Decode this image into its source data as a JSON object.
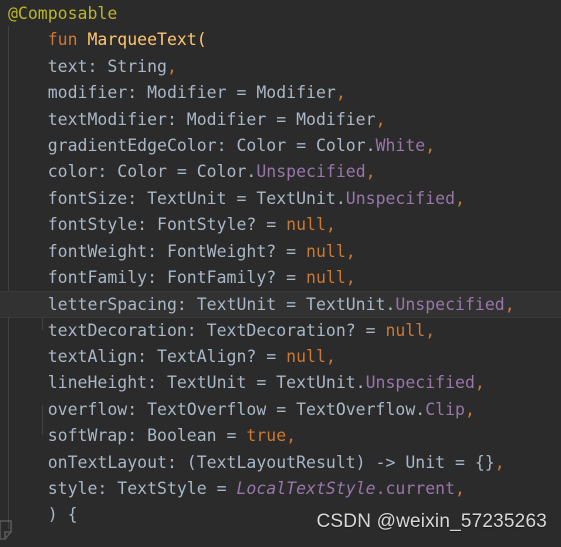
{
  "editor": {
    "theme_name": "darcula",
    "background": "#2b2b2b",
    "current_line_background": "#323232",
    "default_text_color": "#a9b7c6",
    "language": "kotlin",
    "colors": {
      "annotation": "#bbb529",
      "keyword": "#cc7832",
      "function_declaration": "#ffc66d",
      "static_field": "#9876aa",
      "identifier": "#a9b7c6"
    },
    "lines": [
      {
        "index": 1,
        "current": false,
        "tokens": [
          {
            "text": "@Composable",
            "type": "annotation"
          }
        ]
      },
      {
        "index": 2,
        "current": false,
        "tokens": [
          {
            "text": "    ",
            "type": "default"
          },
          {
            "text": "fun",
            "type": "keyword"
          },
          {
            "text": " ",
            "type": "default"
          },
          {
            "text": "MarqueeText",
            "type": "function_declaration"
          },
          {
            "text": "(",
            "type": "function_declaration"
          }
        ]
      },
      {
        "index": 3,
        "current": false,
        "tokens": [
          {
            "text": "    text: String",
            "type": "default"
          },
          {
            "text": ",",
            "type": "keyword"
          }
        ]
      },
      {
        "index": 4,
        "current": false,
        "tokens": [
          {
            "text": "    modifier: Modifier = Modifier",
            "type": "default"
          },
          {
            "text": ",",
            "type": "keyword"
          }
        ]
      },
      {
        "index": 5,
        "current": false,
        "tokens": [
          {
            "text": "    textModifier: Modifier = Modifier",
            "type": "default"
          },
          {
            "text": ",",
            "type": "keyword"
          }
        ]
      },
      {
        "index": 6,
        "current": false,
        "tokens": [
          {
            "text": "    gradientEdgeColor: Color = Color.",
            "type": "default"
          },
          {
            "text": "White",
            "type": "static_field"
          },
          {
            "text": ",",
            "type": "keyword"
          }
        ]
      },
      {
        "index": 7,
        "current": false,
        "tokens": [
          {
            "text": "    color: Color = Color.",
            "type": "default"
          },
          {
            "text": "Unspecified",
            "type": "static_field"
          },
          {
            "text": ",",
            "type": "keyword"
          }
        ]
      },
      {
        "index": 8,
        "current": false,
        "tokens": [
          {
            "text": "    fontSize: TextUnit = TextUnit.",
            "type": "default"
          },
          {
            "text": "Unspecified",
            "type": "static_field"
          },
          {
            "text": ",",
            "type": "keyword"
          }
        ]
      },
      {
        "index": 9,
        "current": false,
        "tokens": [
          {
            "text": "    fontStyle: FontStyle? = ",
            "type": "default"
          },
          {
            "text": "null",
            "type": "keyword"
          },
          {
            "text": ",",
            "type": "keyword"
          }
        ]
      },
      {
        "index": 10,
        "current": false,
        "tokens": [
          {
            "text": "    fontWeight: FontWeight? = ",
            "type": "default"
          },
          {
            "text": "null",
            "type": "keyword"
          },
          {
            "text": ",",
            "type": "keyword"
          }
        ]
      },
      {
        "index": 11,
        "current": false,
        "tokens": [
          {
            "text": "    fontFamily: FontFamily? = ",
            "type": "default"
          },
          {
            "text": "null",
            "type": "keyword"
          },
          {
            "text": ",",
            "type": "keyword"
          }
        ]
      },
      {
        "index": 12,
        "current": true,
        "tokens": [
          {
            "text": "    letterSpacing: TextUnit = TextUnit.",
            "type": "default"
          },
          {
            "text": "Unspecified",
            "type": "static_field"
          },
          {
            "text": ",",
            "type": "keyword"
          }
        ]
      },
      {
        "index": 13,
        "current": false,
        "tokens": [
          {
            "text": "    textDecoration: TextDecoration? = ",
            "type": "default"
          },
          {
            "text": "null",
            "type": "keyword"
          },
          {
            "text": ",",
            "type": "keyword"
          }
        ]
      },
      {
        "index": 14,
        "current": false,
        "tokens": [
          {
            "text": "    textAlign: TextAlign? = ",
            "type": "default"
          },
          {
            "text": "null",
            "type": "keyword"
          },
          {
            "text": ",",
            "type": "keyword"
          }
        ]
      },
      {
        "index": 15,
        "current": false,
        "tokens": [
          {
            "text": "    lineHeight: TextUnit = TextUnit.",
            "type": "default"
          },
          {
            "text": "Unspecified",
            "type": "static_field"
          },
          {
            "text": ",",
            "type": "keyword"
          }
        ]
      },
      {
        "index": 16,
        "current": false,
        "tokens": [
          {
            "text": "    overflow: TextOverflow = TextOverflow.",
            "type": "default"
          },
          {
            "text": "Clip",
            "type": "static_field"
          },
          {
            "text": ",",
            "type": "keyword"
          }
        ]
      },
      {
        "index": 17,
        "current": false,
        "tokens": [
          {
            "text": "    softWrap: Boolean = ",
            "type": "default"
          },
          {
            "text": "true",
            "type": "keyword"
          },
          {
            "text": ",",
            "type": "keyword"
          }
        ]
      },
      {
        "index": 18,
        "current": false,
        "tokens": [
          {
            "text": "    onTextLayout: (TextLayoutResult) -> Unit = {}",
            "type": "default"
          },
          {
            "text": ",",
            "type": "keyword"
          }
        ]
      },
      {
        "index": 19,
        "current": false,
        "tokens": [
          {
            "text": "    style: TextStyle = ",
            "type": "default"
          },
          {
            "text": "LocalTextStyle",
            "type": "static_field_italic"
          },
          {
            "text": ".current",
            "type": "static_field"
          },
          {
            "text": ",",
            "type": "keyword"
          }
        ]
      },
      {
        "index": 20,
        "current": false,
        "tokens": [
          {
            "text": "    ) {",
            "type": "default"
          }
        ]
      }
    ]
  },
  "watermark": {
    "text": "CSDN @weixin_57235263",
    "color": "#d8d8d8"
  },
  "gutter": {
    "fold_marker_icon": "code-fold-icon"
  }
}
